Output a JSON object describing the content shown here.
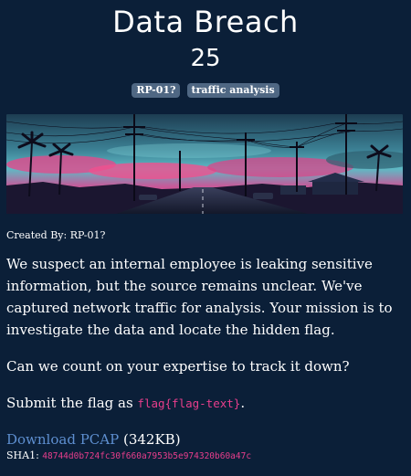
{
  "challenge": {
    "title": "Data Breach",
    "points": "25",
    "tags": [
      "RP-01?",
      "traffic analysis"
    ]
  },
  "banner": {
    "alt": "synthwave street with palm trees and power lines"
  },
  "description": {
    "created_by": "Created By: RP-01?",
    "paragraph1": "We suspect an internal employee is leaking sensitive information, but the source remains unclear. We've captured network traffic for analysis. Your mission is to investigate the data and locate the hidden flag.",
    "paragraph2": "Can we count on your expertise to track it down?",
    "flag_prefix": "Submit the flag as ",
    "flag_format": "flag{flag-text}",
    "flag_suffix": "."
  },
  "download": {
    "link_label": "Download PCAP",
    "size": "(342KB)",
    "sha_label": "SHA1:",
    "sha_value": "48744d0b724fc30f660a7953b5e974320b60a47c"
  },
  "colors": {
    "background": "#0b1f38",
    "tag_bg": "#4f6783",
    "code": "#e83e8c",
    "link": "#5e8fd0"
  }
}
